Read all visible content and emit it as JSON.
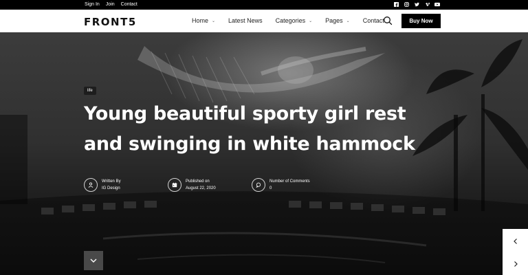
{
  "topbar": {
    "links": [
      "Sign In",
      "Join",
      "Contact"
    ],
    "social_icons": [
      "facebook-icon",
      "instagram-icon",
      "twitter-icon",
      "vimeo-icon",
      "youtube-icon"
    ]
  },
  "header": {
    "logo": "FRONT5",
    "nav": [
      {
        "label": "Home",
        "has_dropdown": true
      },
      {
        "label": "Latest News",
        "has_dropdown": false
      },
      {
        "label": "Categories",
        "has_dropdown": true
      },
      {
        "label": "Pages",
        "has_dropdown": true
      },
      {
        "label": "Contact",
        "has_dropdown": false
      }
    ],
    "search_icon": "search-icon",
    "cta_label": "Buy Now"
  },
  "hero": {
    "category": "life",
    "title": "Young beautiful sporty girl rest and swinging in white hammock",
    "meta": {
      "author": {
        "label": "Written By",
        "value": "IG Design",
        "icon": "user-icon"
      },
      "published": {
        "label": "Published on",
        "value": "August 22, 2020",
        "icon": "calendar-icon"
      },
      "comments": {
        "label": "Number of Comments",
        "value": "0",
        "icon": "comment-icon"
      }
    },
    "scroll_icon": "chevron-down-icon",
    "slider_prev_icon": "chevron-left-icon",
    "slider_next_icon": "chevron-right-icon"
  },
  "colors": {
    "topbar_bg": "#000000",
    "nav_bg": "#ffffff",
    "cta_bg": "#000000",
    "text_light": "#ffffff"
  }
}
